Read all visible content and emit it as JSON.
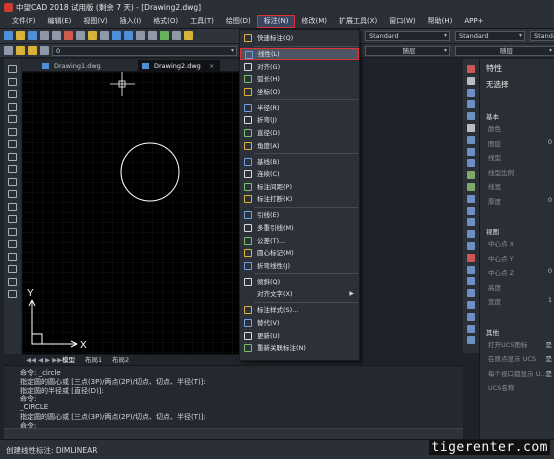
{
  "window": {
    "title": "中望CAD 2018 试用版 (剩余 7 天) - [Drawing2.dwg]"
  },
  "menubar": {
    "items": [
      "文件(F)",
      "编辑(E)",
      "视图(V)",
      "插入(I)",
      "格式(O)",
      "工具(T)",
      "绘图(D)",
      "标注(N)",
      "修改(M)",
      "扩展工具(X)",
      "窗口(W)",
      "帮助(H)",
      "APP+"
    ],
    "active": "标注(N)"
  },
  "toolbar": {
    "layer_value": "0",
    "style1": "Standard",
    "style2": "Standard",
    "style3": "Standard",
    "layer_right1": "随层",
    "layer_right2": "随层"
  },
  "tabs": [
    {
      "label": "Drawing1.dwg"
    },
    {
      "label": "Drawing2.dwg"
    }
  ],
  "dimension_menu": {
    "items": [
      {
        "label": "快速标注(Q)",
        "icon": "quick-dimension-icon"
      },
      {
        "label": "线性(L)",
        "icon": "linear-dimension-icon",
        "highlighted": true
      },
      {
        "label": "对齐(G)",
        "icon": "aligned-dimension-icon"
      },
      {
        "label": "弧长(H)",
        "icon": "arc-length-icon"
      },
      {
        "label": "坐标(O)",
        "icon": "ordinate-icon"
      },
      {
        "label": "半径(R)",
        "icon": "radius-icon"
      },
      {
        "label": "折弯(J)",
        "icon": "jogged-icon"
      },
      {
        "label": "直径(D)",
        "icon": "diameter-icon"
      },
      {
        "label": "角度(A)",
        "icon": "angular-icon"
      },
      {
        "label": "基线(B)",
        "icon": "baseline-icon"
      },
      {
        "label": "连续(C)",
        "icon": "continue-icon"
      },
      {
        "label": "标注间距(P)",
        "icon": "dimension-space-icon"
      },
      {
        "label": "标注打断(K)",
        "icon": "dimension-break-icon"
      },
      {
        "label": "引线(E)",
        "icon": "leader-icon"
      },
      {
        "label": "多重引线(M)",
        "icon": "multileader-icon"
      },
      {
        "label": "公差(T)...",
        "icon": "tolerance-icon"
      },
      {
        "label": "圆心标记(M)",
        "icon": "center-mark-icon"
      },
      {
        "label": "折弯线性(J)",
        "icon": "jogged-linear-icon"
      },
      {
        "label": "倾斜(Q)",
        "icon": "oblique-icon"
      },
      {
        "label": "对齐文字(X)",
        "icon": "",
        "submenu": true
      },
      {
        "label": "标注样式(S)...",
        "icon": "dimension-style-icon"
      },
      {
        "label": "替代(V)",
        "icon": "override-icon"
      },
      {
        "label": "更新(U)",
        "icon": "update-icon"
      },
      {
        "label": "重新关联标注(N)",
        "icon": "reassociate-icon"
      }
    ]
  },
  "properties": {
    "title": "特性",
    "selection": "无选择",
    "sections": [
      {
        "title": "基本",
        "rows": [
          "颜色",
          "图层",
          "线型",
          "线型比例",
          "线宽",
          "厚度"
        ],
        "values": [
          "",
          "0",
          "",
          "",
          "",
          "0"
        ]
      },
      {
        "title": "视图",
        "rows": [
          "中心点 X",
          "中心点 Y",
          "中心点 Z",
          "高度",
          "宽度"
        ],
        "values": [
          "",
          "",
          "0",
          "",
          "1"
        ]
      },
      {
        "title": "其他",
        "rows": [
          "打开UCS图标",
          "在原点显示 UCS",
          "每个视口都显示 U...",
          "UCS名称"
        ],
        "values": [
          "是",
          "是",
          "是",
          ""
        ]
      }
    ]
  },
  "layout_tabs": [
    "模型",
    "布局1",
    "布局2"
  ],
  "command_history": [
    "命令: _circle",
    "指定圆的圆心或 [三点(3P)/两点(2P)/切点、切点、半径(T)]:",
    "指定圆的半径或 [直径(D)]:",
    "命令:",
    "_CIRCLE",
    "指定圆的圆心或 [三点(3P)/两点(2P)/切点、切点、半径(T)]:",
    "命令:"
  ],
  "status_text": "创建线性标注: DIMLINEAR",
  "watermark": "tigerenter.com",
  "canvas": {
    "x_axis": "X",
    "y_axis": "Y"
  },
  "colors": {
    "background": "#1e222a",
    "canvas": "#000000",
    "highlight": "#e03333",
    "menu_bg": "#2c3038"
  }
}
